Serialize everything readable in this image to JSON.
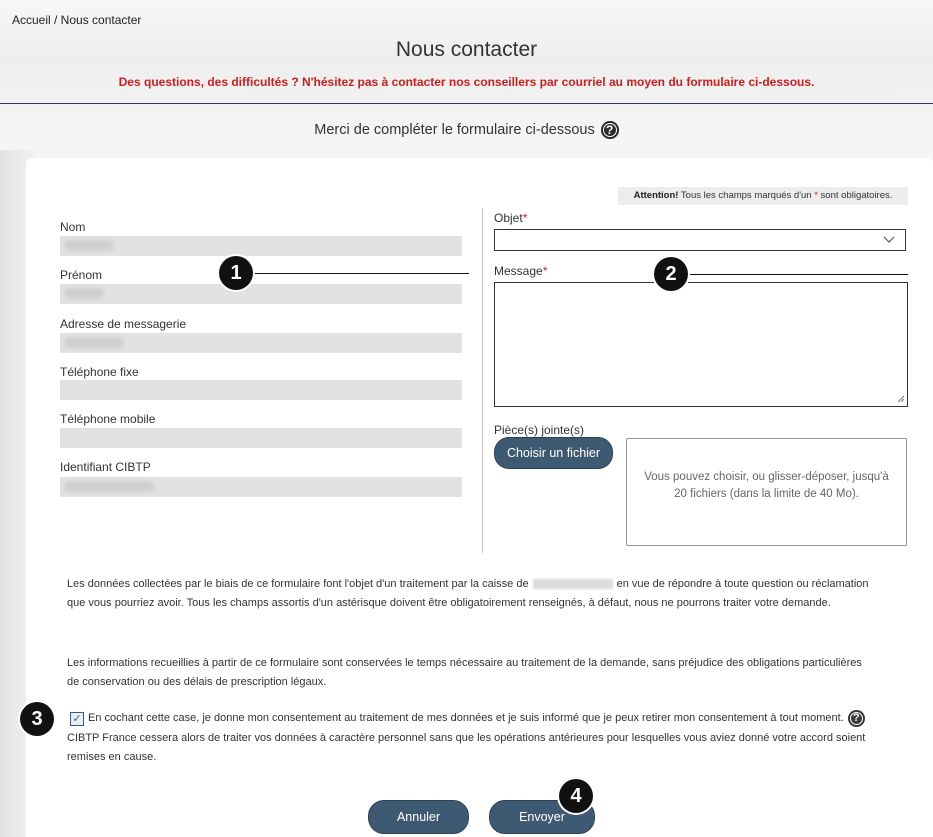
{
  "breadcrumb": "Accueil / Nous contacter",
  "title": "Nous contacter",
  "subtitle": "Des questions, des difficultés ? N'hésitez pas à contacter nos conseillers par courriel au moyen du formulaire ci-dessous.",
  "intro": "Merci de compléter le formulaire ci-dessous",
  "help_icon": "?",
  "note": {
    "strong": "Attention!",
    "before": " Tous les champs marqués d'un ",
    "star": "*",
    "after": " sont obligatoires."
  },
  "left_fields": [
    {
      "label": "Nom"
    },
    {
      "label": "Prénom"
    },
    {
      "label": "Adresse de messagerie"
    },
    {
      "label": "Téléphone fixe"
    },
    {
      "label": "Téléphone mobile"
    },
    {
      "label": "Identifiant CIBTP"
    }
  ],
  "objet": {
    "label": "Objet",
    "required": "*",
    "value": ""
  },
  "message": {
    "label": "Message",
    "required": "*",
    "value": ""
  },
  "attachments": {
    "label": "Pièce(s) jointe(s)",
    "button": "Choisir un fichier",
    "dropzone_text": "Vous pouvez choisir, ou glisser-déposer, jusqu'à 20 fichiers (dans la limite de 40 Mo)."
  },
  "privacy": {
    "p1_before": "Les données collectées par le biais de ce formulaire font l'objet d'un traitement par la caisse de",
    "p1_after": "en vue de répondre à toute question ou réclamation que vous pourriez avoir. Tous les champs assortis d'un astérisque doivent être obligatoirement renseignés, à défaut, nous ne pourrons traiter votre demande.",
    "p2": "Les informations recueillies à partir de ce formulaire sont conservées le temps nécessaire au traitement de la demande, sans préjudice des obligations particulières de conservation ou des délais de prescription légaux."
  },
  "consent": {
    "checked": true,
    "check_mark": "✓",
    "text_before": "En cochant cette case, je donne mon consentement au traitement de mes données et je suis informé que je peux retirer mon consentement à tout moment.",
    "text_after": "CIBTP France cessera alors de traiter vos données à caractère personnel sans que les opérations antérieures pour lesquelles vous aviez donné votre accord soient remises en cause."
  },
  "buttons": {
    "cancel": "Annuler",
    "send": "Envoyer"
  },
  "markers": [
    "1",
    "2",
    "3",
    "4"
  ],
  "colors": {
    "accent": "#3e5a72",
    "required": "#d21c1c",
    "rule": "#1f3f66"
  }
}
